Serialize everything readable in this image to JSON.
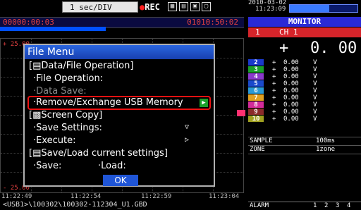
{
  "toolbar": {
    "timebase": "1 sec/DIV",
    "rec_label": "REC"
  },
  "timeline": {
    "elapsed": "00000:00:03",
    "position": "01010:50:02"
  },
  "graph": {
    "y_top_label": "+ 25.00",
    "y_bottom_label": "- 25.00",
    "time_ticks": [
      "11:22:49",
      "11:22:54",
      "11:22:59",
      "11:23:04"
    ],
    "file_path": "<USB1>\\100302\\100302-112304_U1.GBD"
  },
  "status": {
    "date": "2010-03-02",
    "time": "11:23:09",
    "battery_level": 0.58
  },
  "monitor": {
    "title": "MONITOR",
    "ch1_label": "CH 1",
    "ch1_num": "1",
    "ch1_sign": "+",
    "ch1_value": "0. 00",
    "channels": [
      {
        "num": "2",
        "sign": "+",
        "value": "0.00",
        "unit": "V",
        "color": "#1a3acc"
      },
      {
        "num": "3",
        "sign": "+",
        "value": "0.00",
        "unit": "V",
        "color": "#1aa02a"
      },
      {
        "num": "4",
        "sign": "+",
        "value": "0.00",
        "unit": "V",
        "color": "#8a3acc"
      },
      {
        "num": "5",
        "sign": "+",
        "value": "0.00",
        "unit": "V",
        "color": "#1a4acc"
      },
      {
        "num": "6",
        "sign": "+",
        "value": "0.00",
        "unit": "V",
        "color": "#2a9ad6"
      },
      {
        "num": "7",
        "sign": "+",
        "value": "0.00",
        "unit": "V",
        "color": "#e0a020"
      },
      {
        "num": "8",
        "sign": "+",
        "value": "0.00",
        "unit": "V",
        "color": "#d42a9a"
      },
      {
        "num": "9",
        "sign": "+",
        "value": "0.00",
        "unit": "V",
        "color": "#8a2a2a"
      },
      {
        "num": "10",
        "sign": "+",
        "value": "0.00",
        "unit": "V",
        "color": "#a0a020"
      }
    ],
    "sample_label": "SAMPLE",
    "sample_value": "100ms",
    "zone_label": "ZONE",
    "zone_value": "1zone",
    "alarm_label": "ALARM",
    "alarm_channels": [
      "1",
      "2",
      "3",
      "4"
    ]
  },
  "dialog": {
    "title": "File Menu",
    "section_data": "[▤Data/File Operation]",
    "file_operation": "·File Operation:",
    "data_save": "·Data Save:",
    "remove_usb": "·Remove/Exchange USB Memory",
    "section_screen": "[▩Screen Copy]",
    "save_settings": "·Save Settings:",
    "execute": "·Execute:",
    "section_settings": "[▤Save/Load current settings]",
    "save": "·Save:",
    "load": "·Load:",
    "ok": "OK"
  }
}
